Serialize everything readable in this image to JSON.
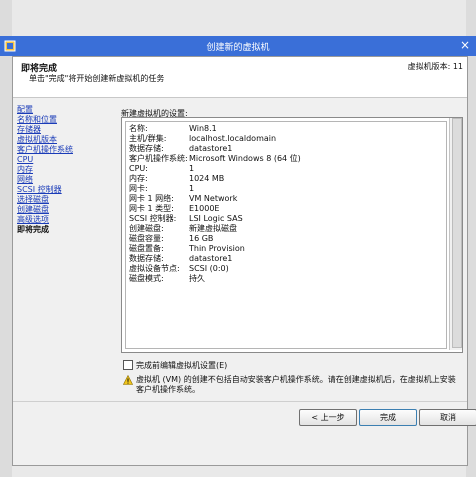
{
  "window": {
    "title": "创建新的虚拟机"
  },
  "header": {
    "title": "即将完成",
    "subtitle": "单击\"完成\"将开始创建新虚拟机的任务",
    "version": "虚拟机版本: 11"
  },
  "nav": {
    "items": [
      {
        "label": "配置"
      },
      {
        "label": "名称和位置"
      },
      {
        "label": "存储器"
      },
      {
        "label": "虚拟机版本"
      },
      {
        "label": "客户机操作系统"
      },
      {
        "label": "CPU"
      },
      {
        "label": "内存"
      },
      {
        "label": "网络"
      },
      {
        "label": "SCSI 控制器"
      },
      {
        "label": "选择磁盘"
      },
      {
        "label": "创建磁盘"
      },
      {
        "label": "高级选项"
      },
      {
        "label": "即将完成"
      }
    ]
  },
  "settings": {
    "label": "新建虚拟机的设置:",
    "rows": [
      {
        "key": "名称:",
        "value": "Win8.1"
      },
      {
        "key": "主机/群集:",
        "value": "localhost.localdomain"
      },
      {
        "key": "数据存储:",
        "value": "datastore1"
      },
      {
        "key": "客户机操作系统:",
        "value": "Microsoft Windows 8 (64 位)"
      },
      {
        "key": "CPU:",
        "value": "1"
      },
      {
        "key": "内存:",
        "value": "1024 MB"
      },
      {
        "key": "网卡:",
        "value": "1"
      },
      {
        "key": "网卡 1 网络:",
        "value": "VM Network"
      },
      {
        "key": "网卡 1 类型:",
        "value": "E1000E"
      },
      {
        "key": "SCSI 控制器:",
        "value": "LSI Logic SAS"
      },
      {
        "key": "创建磁盘:",
        "value": "新建虚拟磁盘"
      },
      {
        "key": "磁盘容量:",
        "value": "16 GB"
      },
      {
        "key": "磁盘置备:",
        "value": "Thin Provision"
      },
      {
        "key": "数据存储:",
        "value": "datastore1"
      },
      {
        "key": "虚拟设备节点:",
        "value": "SCSI (0:0)"
      },
      {
        "key": "磁盘模式:",
        "value": "持久"
      }
    ]
  },
  "edit_checkbox": {
    "label": "完成前编辑虚拟机设置(E)",
    "checked": false
  },
  "warning": {
    "text": "虚拟机 (VM) 的创建不包括自动安装客户机操作系统。请在创建虚拟机后，在虚拟机上安装客户机操作系统。"
  },
  "buttons": {
    "back": "< 上一步",
    "finish": "完成",
    "cancel": "取消"
  },
  "colors": {
    "titlebar": "#3a6fd8",
    "link": "#1a3bb8",
    "warning": "#f0c419"
  }
}
